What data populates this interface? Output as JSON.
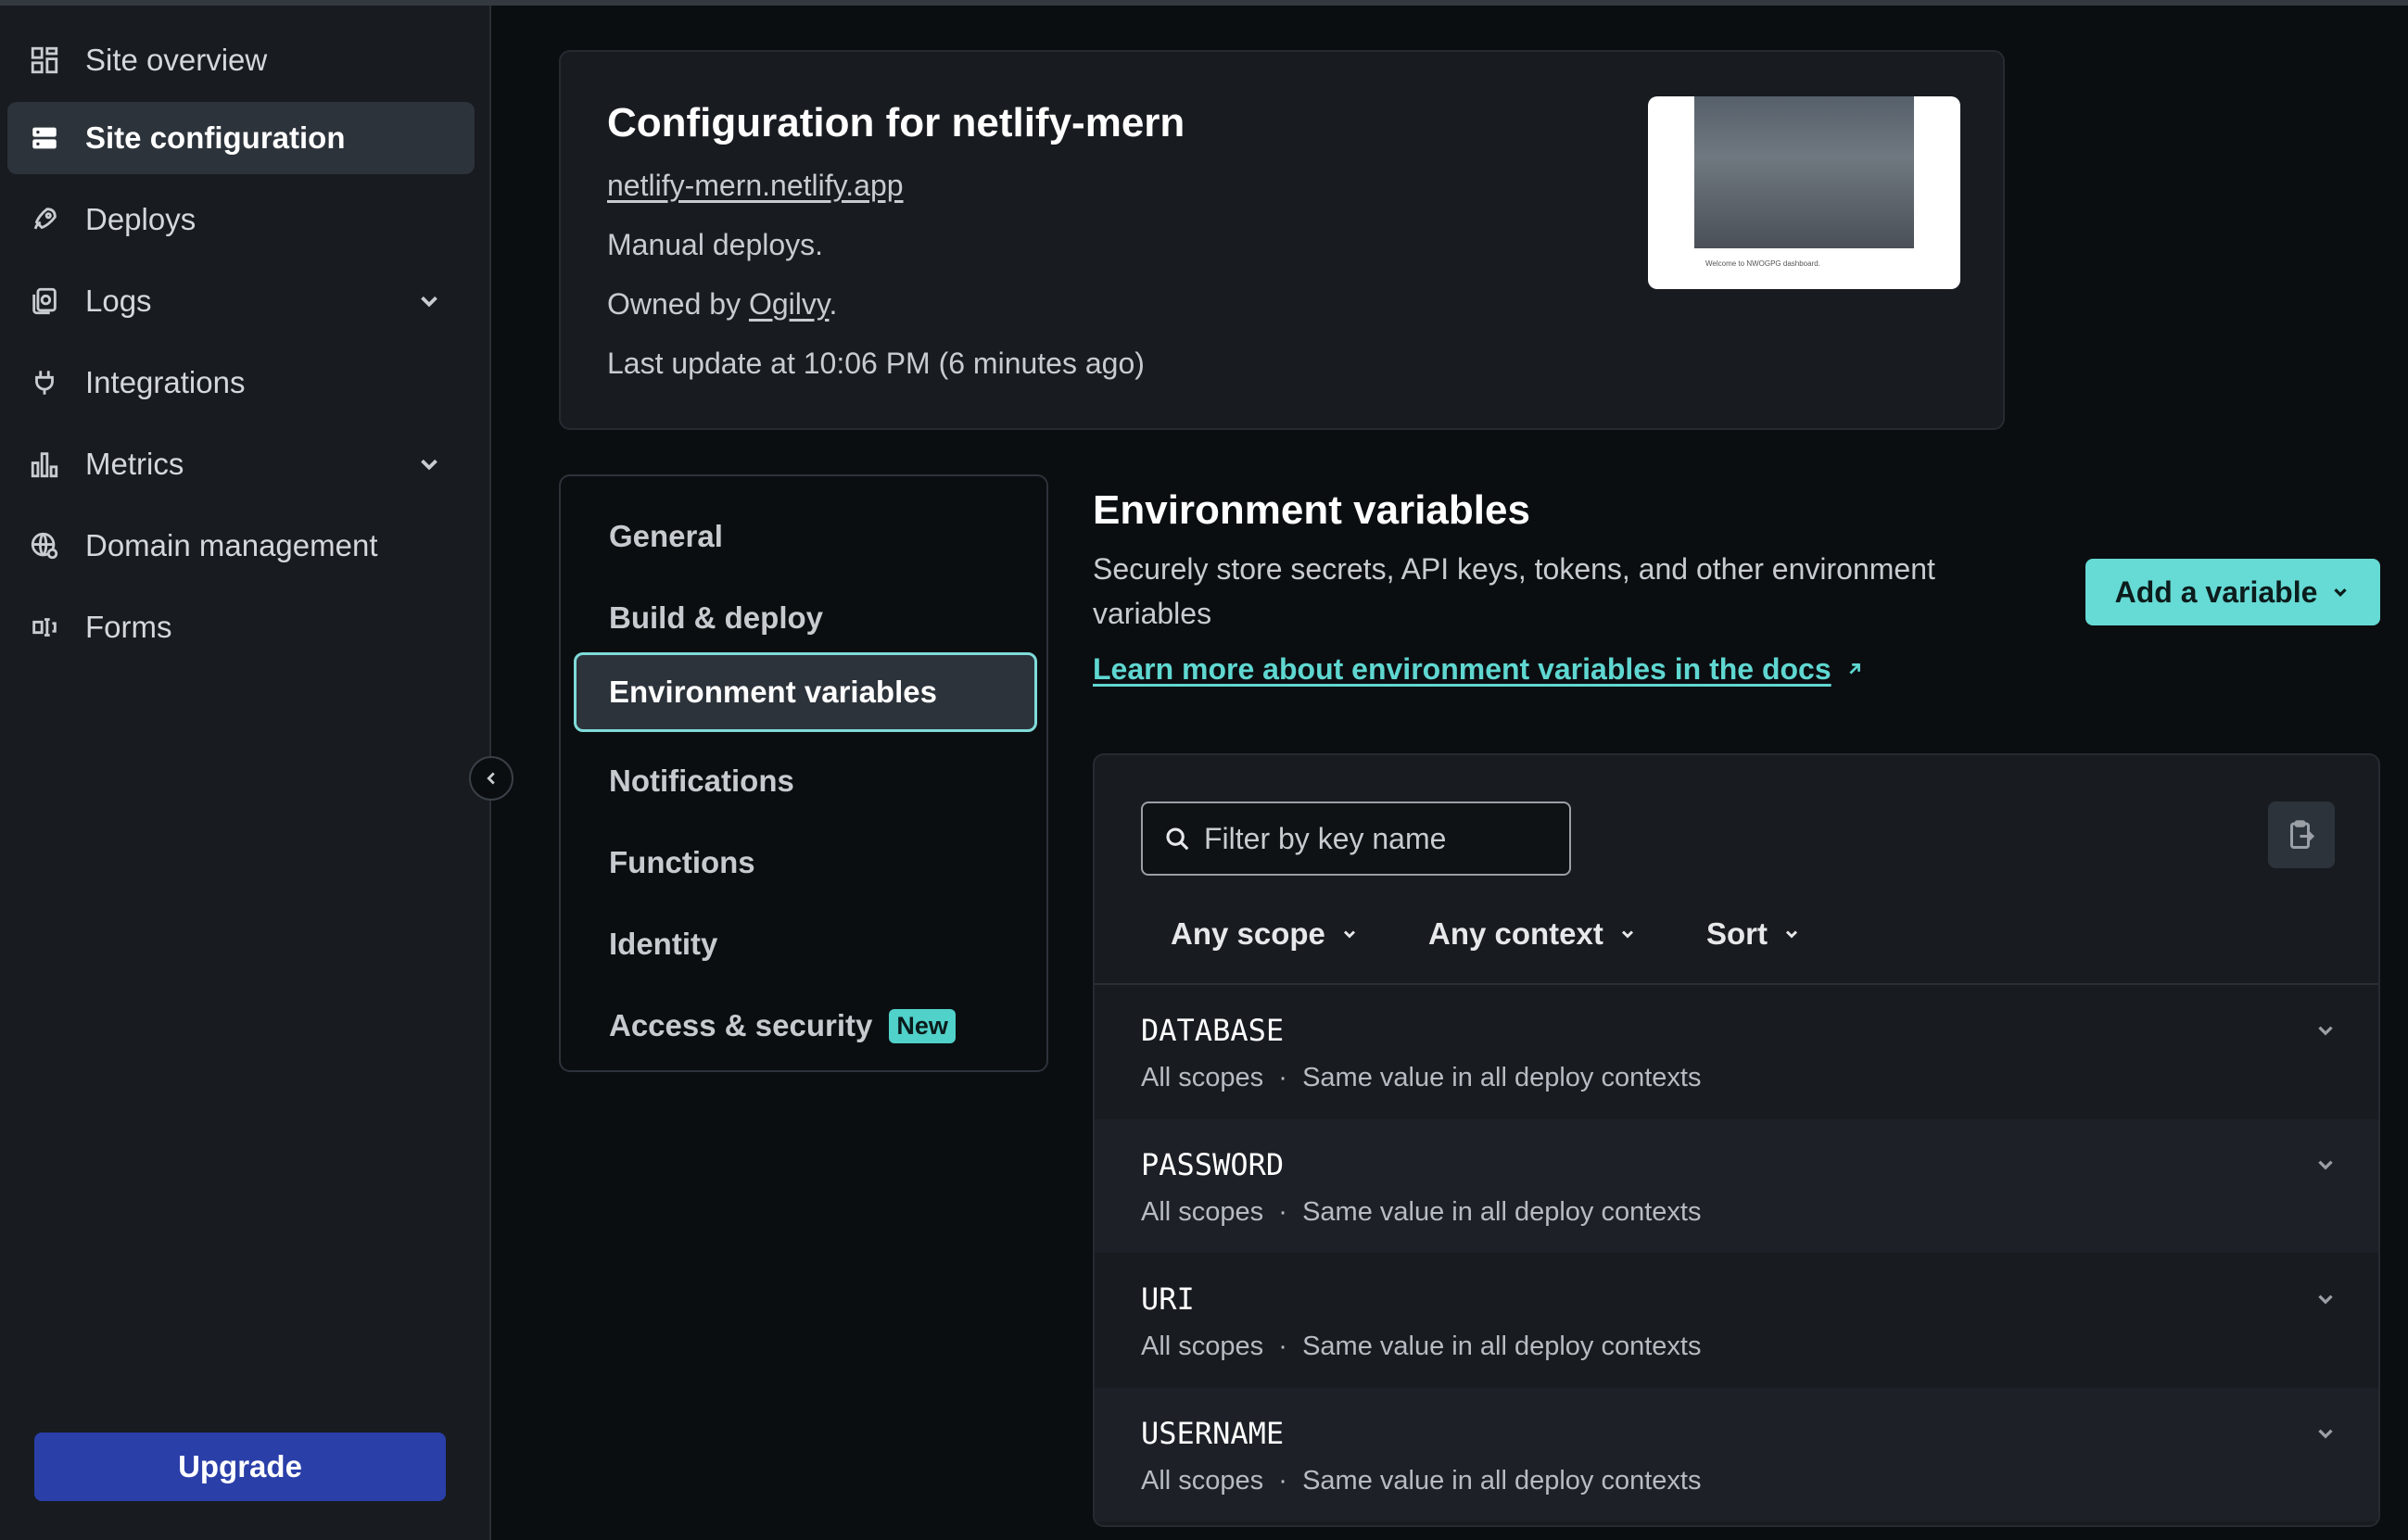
{
  "sidebar": {
    "items": [
      {
        "label": "Site overview",
        "icon": "grid-icon"
      },
      {
        "label": "Site configuration",
        "icon": "server-icon",
        "active": true
      },
      {
        "label": "Deploys",
        "icon": "rocket-icon"
      },
      {
        "label": "Logs",
        "icon": "logs-icon",
        "expandable": true
      },
      {
        "label": "Integrations",
        "icon": "plug-icon"
      },
      {
        "label": "Metrics",
        "icon": "bar-chart-icon",
        "expandable": true
      },
      {
        "label": "Domain management",
        "icon": "globe-icon"
      },
      {
        "label": "Forms",
        "icon": "form-icon"
      }
    ],
    "upgrade_label": "Upgrade"
  },
  "site": {
    "title": "Configuration for netlify-mern",
    "url": "netlify-mern.netlify.app",
    "deploy_mode": "Manual deploys.",
    "owned_prefix": "Owned by ",
    "owner": "Ogilvy",
    "owned_suffix": ".",
    "last_update": "Last update at 10:06 PM (6 minutes ago)",
    "thumbnail_caption": "Welcome to NWOGPG dashboard."
  },
  "settings_nav": {
    "items": [
      {
        "label": "General"
      },
      {
        "label": "Build & deploy"
      },
      {
        "label": "Environment variables",
        "active": true
      },
      {
        "label": "Notifications"
      },
      {
        "label": "Functions"
      },
      {
        "label": "Identity"
      },
      {
        "label": "Access & security",
        "badge": "New"
      }
    ]
  },
  "env": {
    "title": "Environment variables",
    "description": "Securely store secrets, API keys, tokens, and other environment variables",
    "docs_link": "Learn more about environment variables in the docs",
    "add_button": "Add a variable",
    "filter_placeholder": "Filter by key name",
    "filters": {
      "scope": "Any scope",
      "context": "Any context",
      "sort": "Sort"
    },
    "variables": [
      {
        "key": "DATABASE",
        "scopes": "All scopes",
        "context": "Same value in all deploy contexts"
      },
      {
        "key": "PASSWORD",
        "scopes": "All scopes",
        "context": "Same value in all deploy contexts"
      },
      {
        "key": "URI",
        "scopes": "All scopes",
        "context": "Same value in all deploy contexts"
      },
      {
        "key": "USERNAME",
        "scopes": "All scopes",
        "context": "Same value in all deploy contexts"
      }
    ]
  },
  "colors": {
    "accent": "#66dad4",
    "upgrade": "#2a3fa8",
    "background": "#0b0e11",
    "panel": "#181b20"
  }
}
